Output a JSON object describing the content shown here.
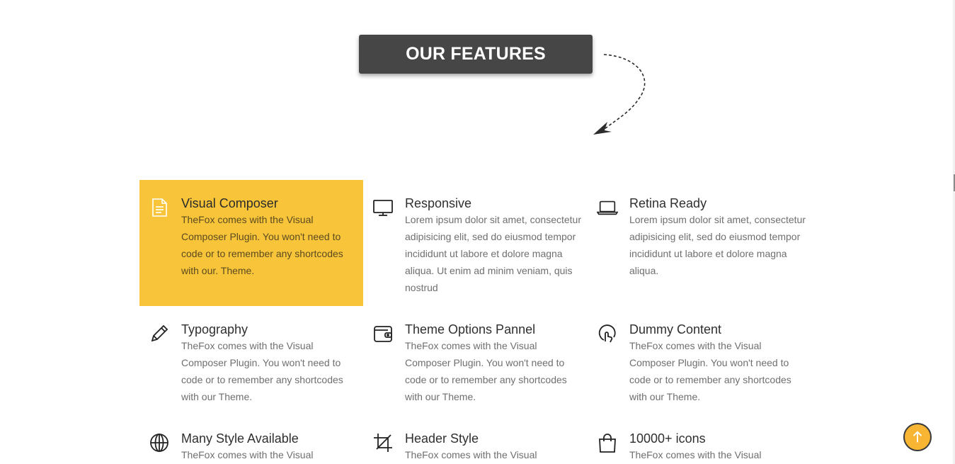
{
  "section": {
    "title": "OUR FEATURES"
  },
  "colors": {
    "accent": "#f8c53a",
    "badge_bg": "#464646",
    "scroll_button": "#f8b534"
  },
  "features": [
    {
      "icon": "document-icon",
      "title": "Visual Composer",
      "text": "TheFox comes with the Visual Composer Plugin. You won't need to code or to remember any shortcodes with our. Theme.",
      "active": true
    },
    {
      "icon": "monitor-icon",
      "title": "Responsive",
      "text": "Lorem ipsum dolor sit amet, consectetur adipisicing elit, sed do eiusmod tempor incididunt ut labore et dolore magna aliqua. Ut enim ad minim veniam, quis nostrud",
      "active": false
    },
    {
      "icon": "laptop-icon",
      "title": "Retina Ready",
      "text": "Lorem ipsum dolor sit amet, consectetur adipisicing elit, sed do eiusmod tempor incididunt ut labore et dolore magna aliqua.",
      "active": false
    },
    {
      "icon": "pencil-icon",
      "title": "Typography",
      "text": "TheFox comes with the Visual Composer Plugin. You won't need to code or to remember any shortcodes with our Theme.",
      "active": false
    },
    {
      "icon": "wallet-icon",
      "title": "Theme Options Pannel",
      "text": "TheFox comes with the Visual Composer Plugin. You won't need to code or to remember any shortcodes with our Theme.",
      "active": false
    },
    {
      "icon": "touch-icon",
      "title": "Dummy Content",
      "text": "TheFox comes with the Visual Composer Plugin. You won't need to code or to remember any shortcodes with our Theme.",
      "active": false
    },
    {
      "icon": "globe-icon",
      "title": "Many Style Available",
      "text": "TheFox comes with the Visual",
      "active": false
    },
    {
      "icon": "crop-icon",
      "title": "Header Style",
      "text": "TheFox comes with the Visual",
      "active": false
    },
    {
      "icon": "shopping-bag-icon",
      "title": "10000+ icons",
      "text": "TheFox comes with the Visual",
      "active": false
    }
  ],
  "scroll_top": {
    "icon": "arrow-up-icon"
  }
}
